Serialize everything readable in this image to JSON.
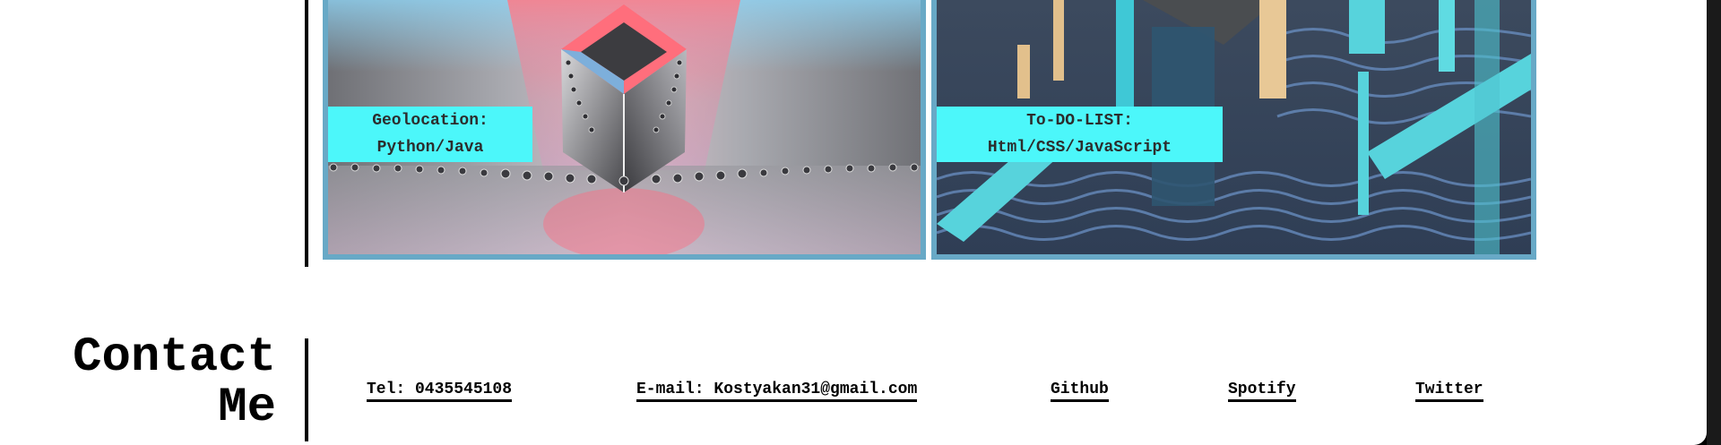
{
  "projects": [
    {
      "line1": "Geolocation:",
      "line2": "Python/Java"
    },
    {
      "line1": "To-DO-LIST:",
      "line2": "Html/CSS/JavaScript"
    }
  ],
  "contact": {
    "title_line1": "Contact",
    "title_line2": "Me",
    "links": {
      "tel": "Tel: 0435545108",
      "email": "E-mail: Kostyakan31@gmail.com",
      "github": "Github",
      "spotify": "Spotify",
      "twitter": "Twitter"
    }
  },
  "colors": {
    "accent_cyan": "#4cf7fa",
    "card_border": "#68a9c6"
  }
}
